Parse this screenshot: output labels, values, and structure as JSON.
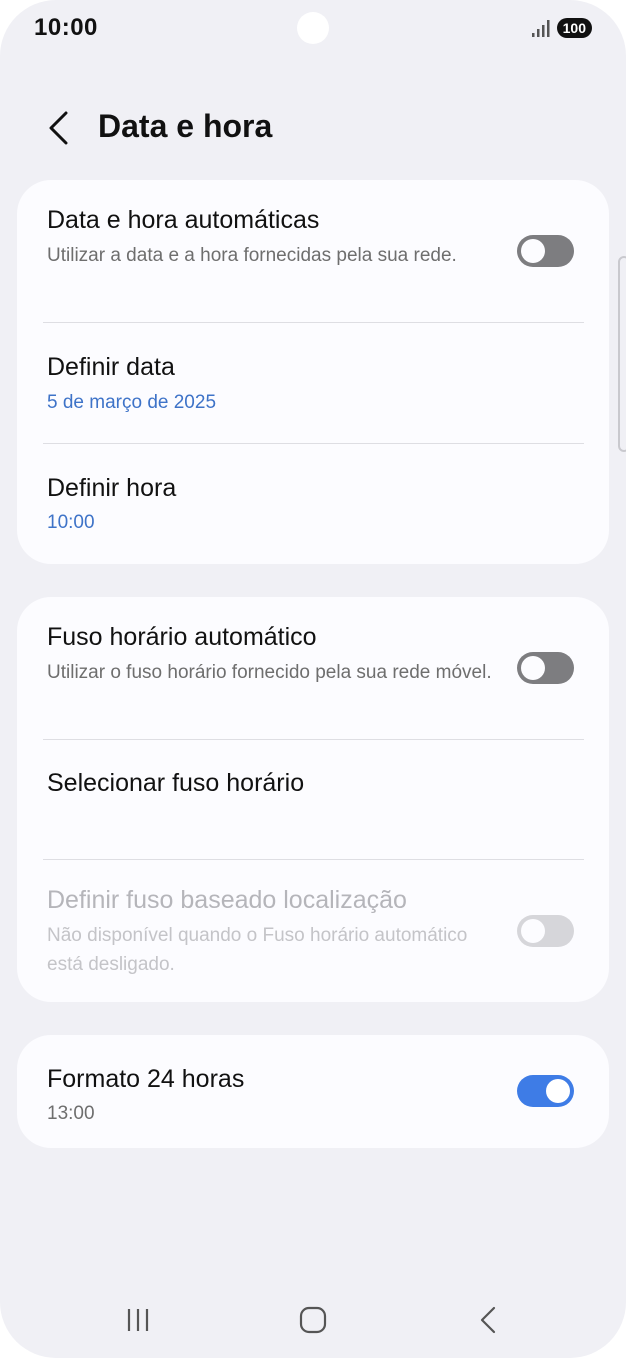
{
  "status_bar": {
    "time": "10:00",
    "battery": "100",
    "signal_icon": "signal-bars-icon"
  },
  "header": {
    "title": "Data e hora",
    "back_icon": "chevron-left-icon"
  },
  "cards": [
    {
      "rows": [
        {
          "title": "Data e hora automáticas",
          "subtitle": "Utilizar a data e a hora fornecidas pela sua rede.",
          "toggle": "off"
        },
        {
          "title": "Definir data",
          "subtitle": "5 de março de 2025"
        },
        {
          "title": "Definir hora",
          "subtitle": "10:00"
        }
      ]
    },
    {
      "rows": [
        {
          "title": "Fuso horário automático",
          "subtitle": "Utilizar o fuso horário fornecido pela sua rede móvel.",
          "toggle": "off"
        },
        {
          "title": "Selecionar fuso horário"
        },
        {
          "title": "Definir fuso baseado localização",
          "subtitle": "Não disponível quando o Fuso horário automático está desligado.",
          "toggle": "off",
          "disabled": true
        }
      ]
    },
    {
      "rows": [
        {
          "title": "Formato 24 horas",
          "subtitle": "13:00",
          "toggle": "on"
        }
      ]
    }
  ],
  "colors": {
    "background": "#f0f0f5",
    "card": "#fcfcff",
    "accent": "#3e7ce6",
    "link_text": "#3e73c8",
    "toggle_off": "#7d7d80"
  },
  "nav_bar": {
    "recents_icon": "recents-icon",
    "home_icon": "home-icon",
    "back_icon": "back-icon"
  }
}
